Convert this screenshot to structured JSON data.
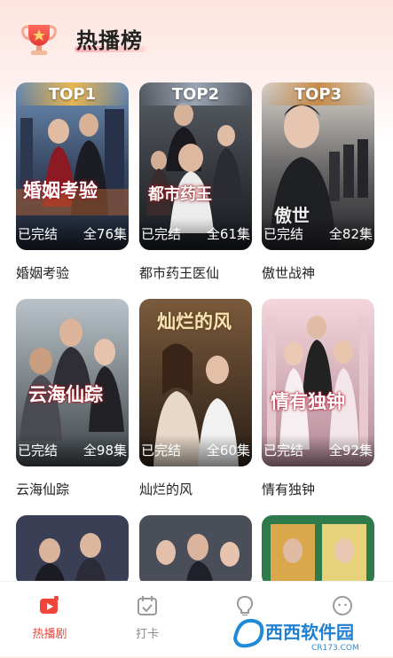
{
  "header": {
    "title": "热播榜",
    "icon": "trophy-icon"
  },
  "cards": [
    {
      "rank": "TOP1",
      "status": "已完结",
      "episodes": "全76集",
      "name": "婚姻考验",
      "poster_text": "婚姻考验"
    },
    {
      "rank": "TOP2",
      "status": "已完结",
      "episodes": "全61集",
      "name": "都市药王医仙",
      "poster_text": "都市药王"
    },
    {
      "rank": "TOP3",
      "status": "已完结",
      "episodes": "全82集",
      "name": "傲世战神",
      "poster_text": "傲世"
    },
    {
      "rank": "",
      "status": "已完结",
      "episodes": "全98集",
      "name": "云海仙踪",
      "poster_text": "云海仙踪"
    },
    {
      "rank": "",
      "status": "已完结",
      "episodes": "全60集",
      "name": "灿烂的风",
      "poster_text": "灿烂的风"
    },
    {
      "rank": "",
      "status": "已完结",
      "episodes": "全92集",
      "name": "情有独钟",
      "poster_text": "情有独钟"
    }
  ],
  "tabbar": {
    "items": [
      {
        "label": "热播剧",
        "icon": "play-video-icon",
        "active": true
      },
      {
        "label": "打卡",
        "icon": "calendar-check-icon",
        "active": false
      },
      {
        "label": "",
        "icon": "lightbulb-icon",
        "active": false
      },
      {
        "label": "",
        "icon": "chat-face-icon",
        "active": false
      }
    ]
  },
  "watermark": {
    "brand": "西西软件园",
    "url": "CR173.COM"
  },
  "colors": {
    "accent": "#f0463a",
    "rank1": "#e9b64f",
    "rank2": "#9aa4b2",
    "rank3": "#c98b4a"
  }
}
